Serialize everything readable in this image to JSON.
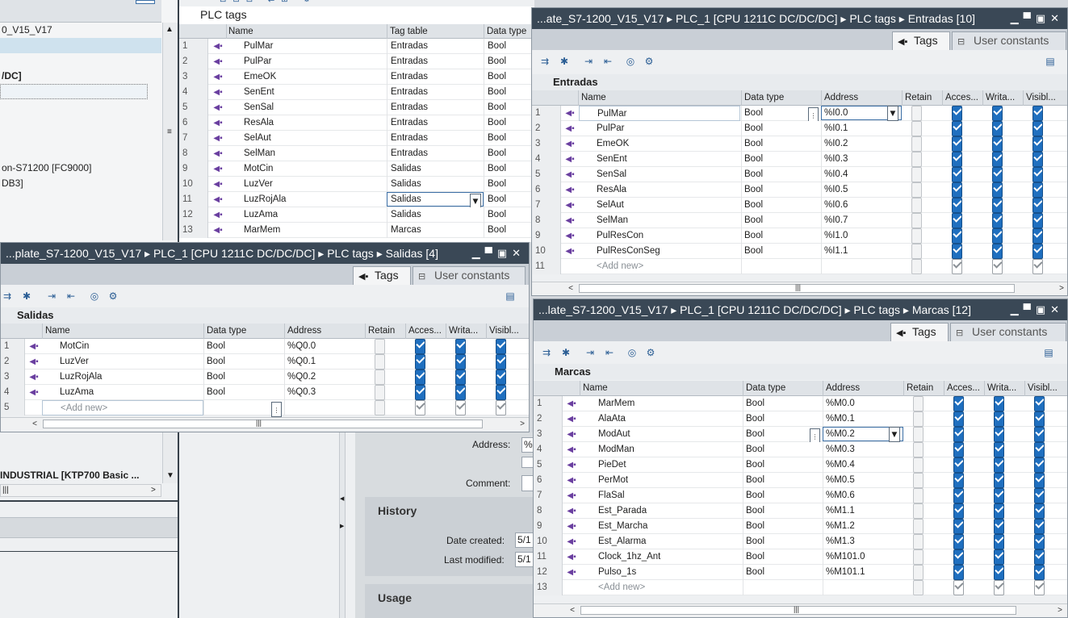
{
  "left_tree": {
    "items": [
      "0_V15_V17",
      "",
      "",
      "/DC]",
      "",
      "",
      "",
      "",
      "",
      "on-S71200 [FC9000]",
      "DB3]"
    ],
    "bottom_item": "INDUSTRIAL [KTP700 Basic ..."
  },
  "plc_tags": {
    "title": "PLC tags",
    "columns": [
      "Name",
      "Tag table",
      "Data type"
    ],
    "rows": [
      {
        "n": "1",
        "name": "PulMar",
        "table": "Entradas",
        "type": "Bool"
      },
      {
        "n": "2",
        "name": "PulPar",
        "table": "Entradas",
        "type": "Bool"
      },
      {
        "n": "3",
        "name": "EmeOK",
        "table": "Entradas",
        "type": "Bool"
      },
      {
        "n": "4",
        "name": "SenEnt",
        "table": "Entradas",
        "type": "Bool"
      },
      {
        "n": "5",
        "name": "SenSal",
        "table": "Entradas",
        "type": "Bool"
      },
      {
        "n": "6",
        "name": "ResAla",
        "table": "Entradas",
        "type": "Bool"
      },
      {
        "n": "7",
        "name": "SelAut",
        "table": "Entradas",
        "type": "Bool"
      },
      {
        "n": "8",
        "name": "SelMan",
        "table": "Entradas",
        "type": "Bool"
      },
      {
        "n": "9",
        "name": "MotCin",
        "table": "Salidas",
        "type": "Bool"
      },
      {
        "n": "10",
        "name": "LuzVer",
        "table": "Salidas",
        "type": "Bool"
      },
      {
        "n": "11",
        "name": "LuzRojAla",
        "table": "Salidas",
        "type": "Bool"
      },
      {
        "n": "12",
        "name": "LuzAma",
        "table": "Salidas",
        "type": "Bool"
      },
      {
        "n": "13",
        "name": "MarMem",
        "table": "Marcas",
        "type": "Bool"
      }
    ]
  },
  "entradas": {
    "title": "...ate_S7-1200_V15_V17 ▸ PLC_1 [CPU 1211C DC/DC/DC] ▸ PLC tags ▸ Entradas [10]",
    "tab_tags": "Tags",
    "tab_constants": "User constants",
    "group": "Entradas",
    "columns": [
      "Name",
      "Data type",
      "Address",
      "Retain",
      "Acces...",
      "Writa...",
      "Visibl..."
    ],
    "rows": [
      {
        "n": "1",
        "name": "PulMar",
        "type": "Bool",
        "addr": "%I0.0"
      },
      {
        "n": "2",
        "name": "PulPar",
        "type": "Bool",
        "addr": "%I0.1"
      },
      {
        "n": "3",
        "name": "EmeOK",
        "type": "Bool",
        "addr": "%I0.2"
      },
      {
        "n": "4",
        "name": "SenEnt",
        "type": "Bool",
        "addr": "%I0.3"
      },
      {
        "n": "5",
        "name": "SenSal",
        "type": "Bool",
        "addr": "%I0.4"
      },
      {
        "n": "6",
        "name": "ResAla",
        "type": "Bool",
        "addr": "%I0.5"
      },
      {
        "n": "7",
        "name": "SelAut",
        "type": "Bool",
        "addr": "%I0.6"
      },
      {
        "n": "8",
        "name": "SelMan",
        "type": "Bool",
        "addr": "%I0.7"
      },
      {
        "n": "9",
        "name": "PulResCon",
        "type": "Bool",
        "addr": "%I1.0"
      },
      {
        "n": "10",
        "name": "PulResConSeg",
        "type": "Bool",
        "addr": "%I1.1"
      }
    ],
    "add_new": "<Add new>",
    "add_new_n": "11"
  },
  "salidas": {
    "title": "...plate_S7-1200_V15_V17 ▸ PLC_1 [CPU 1211C DC/DC/DC] ▸ PLC tags ▸ Salidas [4]",
    "tab_tags": "Tags",
    "tab_constants": "User constants",
    "group": "Salidas",
    "columns": [
      "Name",
      "Data type",
      "Address",
      "Retain",
      "Acces...",
      "Writa...",
      "Visibl..."
    ],
    "rows": [
      {
        "n": "1",
        "name": "MotCin",
        "type": "Bool",
        "addr": "%Q0.0"
      },
      {
        "n": "2",
        "name": "LuzVer",
        "type": "Bool",
        "addr": "%Q0.1"
      },
      {
        "n": "3",
        "name": "LuzRojAla",
        "type": "Bool",
        "addr": "%Q0.2"
      },
      {
        "n": "4",
        "name": "LuzAma",
        "type": "Bool",
        "addr": "%Q0.3"
      }
    ],
    "add_new": "<Add new>",
    "add_new_n": "5"
  },
  "marcas": {
    "title": "...late_S7-1200_V15_V17 ▸ PLC_1 [CPU 1211C DC/DC/DC] ▸ PLC tags ▸ Marcas [12]",
    "tab_tags": "Tags",
    "tab_constants": "User constants",
    "group": "Marcas",
    "columns": [
      "Name",
      "Data type",
      "Address",
      "Retain",
      "Acces...",
      "Writa...",
      "Visibl..."
    ],
    "rows": [
      {
        "n": "1",
        "name": "MarMem",
        "type": "Bool",
        "addr": "%M0.0"
      },
      {
        "n": "2",
        "name": "AlaAta",
        "type": "Bool",
        "addr": "%M0.1"
      },
      {
        "n": "3",
        "name": "ModAut",
        "type": "Bool",
        "addr": "%M0.2"
      },
      {
        "n": "4",
        "name": "ModMan",
        "type": "Bool",
        "addr": "%M0.3"
      },
      {
        "n": "5",
        "name": "PieDet",
        "type": "Bool",
        "addr": "%M0.4"
      },
      {
        "n": "6",
        "name": "PerMot",
        "type": "Bool",
        "addr": "%M0.5"
      },
      {
        "n": "7",
        "name": "FlaSal",
        "type": "Bool",
        "addr": "%M0.6"
      },
      {
        "n": "8",
        "name": "Est_Parada",
        "type": "Bool",
        "addr": "%M1.1"
      },
      {
        "n": "9",
        "name": "Est_Marcha",
        "type": "Bool",
        "addr": "%M1.2"
      },
      {
        "n": "10",
        "name": "Est_Alarma",
        "type": "Bool",
        "addr": "%M1.3"
      },
      {
        "n": "11",
        "name": "Clock_1hz_Ant",
        "type": "Bool",
        "addr": "%M101.0"
      },
      {
        "n": "12",
        "name": "Pulso_1s",
        "type": "Bool",
        "addr": "%M101.1"
      }
    ],
    "add_new": "<Add new>",
    "add_new_n": "13"
  },
  "properties": {
    "address_label": "Address:",
    "address_value": "%",
    "comment_label": "Comment:",
    "history_title": "History",
    "date_created_label": "Date created:",
    "date_created_value": "5/1",
    "last_modified_label": "Last modified:",
    "last_modified_value": "5/1",
    "usage_title": "Usage"
  },
  "colors": {
    "titlebar": "#3a4856",
    "checkbox_on": "#1f6fbf",
    "tag_icon": "#6a3fa0"
  }
}
